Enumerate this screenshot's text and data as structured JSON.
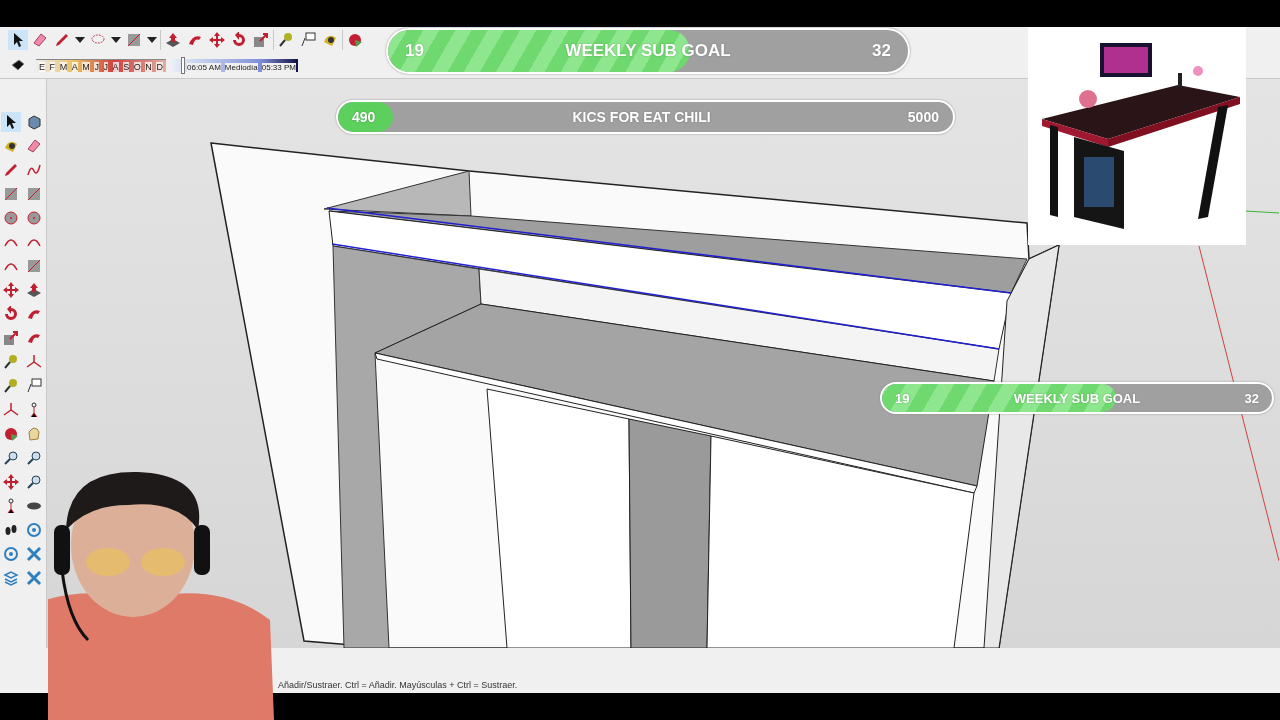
{
  "toolbar": {
    "time_slider": {
      "months": [
        "E",
        "F",
        "M",
        "A",
        "M",
        "J",
        "J",
        "A",
        "S",
        "O",
        "N",
        "D"
      ],
      "start_time": "06:05 AM",
      "midday": "Mediodía",
      "end_time": "05:33 PM",
      "level": 0.07
    }
  },
  "goal_bars": [
    {
      "kind": "striped",
      "current": "19",
      "label": "WEEKLY SUB GOAL",
      "target": "32",
      "level": 0.58
    },
    {
      "kind": "plain",
      "current": "490",
      "label": "KICS FOR EAT CHILI",
      "target": "5000",
      "level": 0.09
    },
    {
      "kind": "striped",
      "current": "19",
      "label": "WEEKLY SUB GOAL",
      "target": "32",
      "level": 0.6
    }
  ],
  "status_bar": {
    "hint": "Añadir/Sustraer. Ctrl = Añadir. Mayúsculas + Ctrl = Sustraer."
  }
}
